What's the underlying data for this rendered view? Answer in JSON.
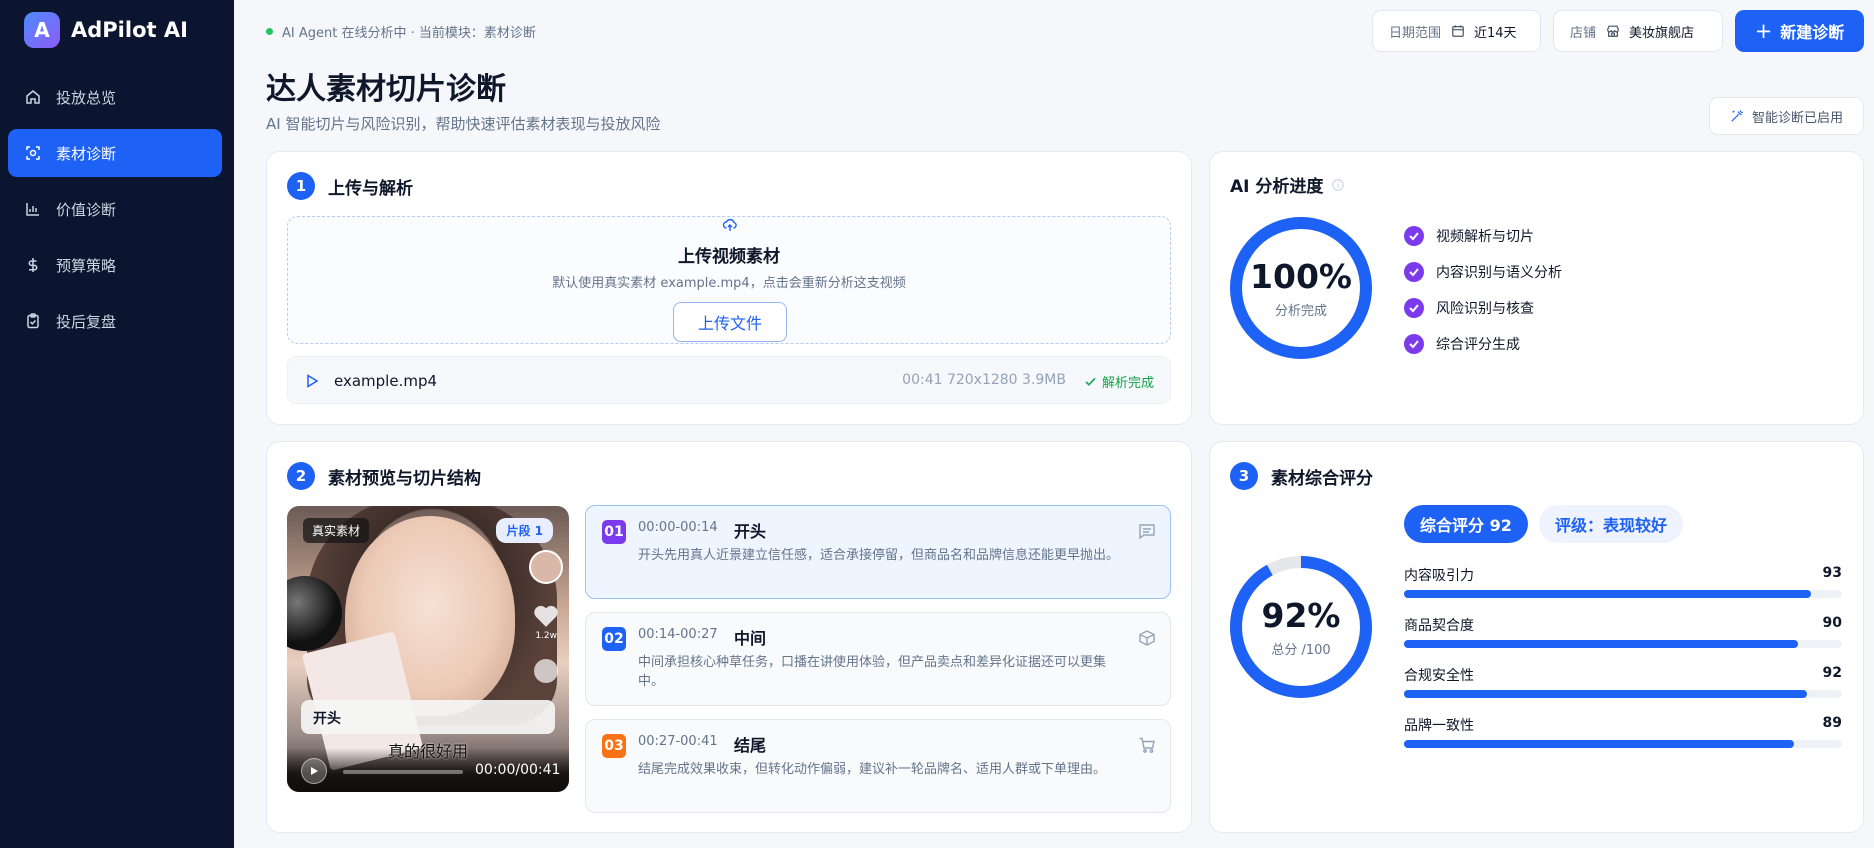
{
  "app": {
    "logo_letter": "A",
    "name": "AdPilot AI"
  },
  "sidebar": {
    "items": [
      {
        "label": "投放总览",
        "icon": "home-icon",
        "active": false
      },
      {
        "label": "素材诊断",
        "icon": "scan-icon",
        "active": true
      },
      {
        "label": "价值诊断",
        "icon": "bar-chart-icon",
        "active": false
      },
      {
        "label": "预算策略",
        "icon": "dollar-icon",
        "active": false
      },
      {
        "label": "投后复盘",
        "icon": "clipboard-check-icon",
        "active": false
      }
    ]
  },
  "header": {
    "status": "AI Agent 在线分析中 · 当前模块：素材诊断",
    "date_label": "日期范围",
    "date_value": "近14天",
    "store_label": "店铺",
    "store_value": "美妆旗舰店",
    "new_button": "新建诊断"
  },
  "page": {
    "title": "达人素材切片诊断",
    "subtitle": "AI 智能切片与风险识别，帮助快速评估素材表现与投放风险",
    "smart_badge": "智能诊断已启用"
  },
  "upload_card": {
    "step": "1",
    "title": "上传与解析",
    "upload_title": "上传视频素材",
    "upload_desc": "默认使用真实素材 example.mp4，点击会重新分析这支视频",
    "upload_button": "上传文件",
    "file_name": "example.mp4",
    "file_meta": "00:41 720x1280 3.9MB",
    "file_status": "解析完成"
  },
  "progress_card": {
    "title": "AI 分析进度",
    "percent": 100,
    "percent_text": "100%",
    "caption": "分析完成",
    "steps": [
      "视频解析与切片",
      "内容识别与语义分析",
      "风险识别与核查",
      "综合评分生成"
    ]
  },
  "preview_card": {
    "step": "2",
    "title": "素材预览与切片结构",
    "tag_real": "真实素材",
    "tag_segment": "片段 1",
    "likes": "1.2w",
    "caption": "开头",
    "subtitle_text": "真的很好用",
    "progress": 0.0,
    "time": "00:00/00:41",
    "segments": [
      {
        "num": "01",
        "time": "00:00-00:14",
        "name": "开头",
        "desc": "开头先用真人近景建立信任感，适合承接停留，但商品名和品牌信息还能更早抛出。",
        "color": "#7c3aed",
        "icon": "comment-icon",
        "active": true
      },
      {
        "num": "02",
        "time": "00:14-00:27",
        "name": "中间",
        "desc": "中间承担核心种草任务，口播在讲使用体验，但产品卖点和差异化证据还可以更集中。",
        "color": "#1e62f5",
        "icon": "package-icon",
        "active": false
      },
      {
        "num": "03",
        "time": "00:27-00:41",
        "name": "结尾",
        "desc": "结尾完成效果收束，但转化动作偏弱，建议补一轮品牌名、适用人群或下单理由。",
        "color": "#f97316",
        "icon": "cart-icon",
        "active": false
      }
    ]
  },
  "score_card": {
    "step": "3",
    "title": "素材综合评分",
    "percent": 92,
    "percent_text": "92%",
    "caption": "总分 /100",
    "score_badge": "综合评分 92",
    "level_badge": "评级：表现较好",
    "metrics": [
      {
        "label": "内容吸引力",
        "value": 93
      },
      {
        "label": "商品契合度",
        "value": 90
      },
      {
        "label": "合规安全性",
        "value": 92
      },
      {
        "label": "品牌一致性",
        "value": 89
      }
    ]
  },
  "colors": {
    "primary": "#1e62f5",
    "sidebar": "#0b1530",
    "success": "#16a34a",
    "check": "#7c3aed"
  }
}
